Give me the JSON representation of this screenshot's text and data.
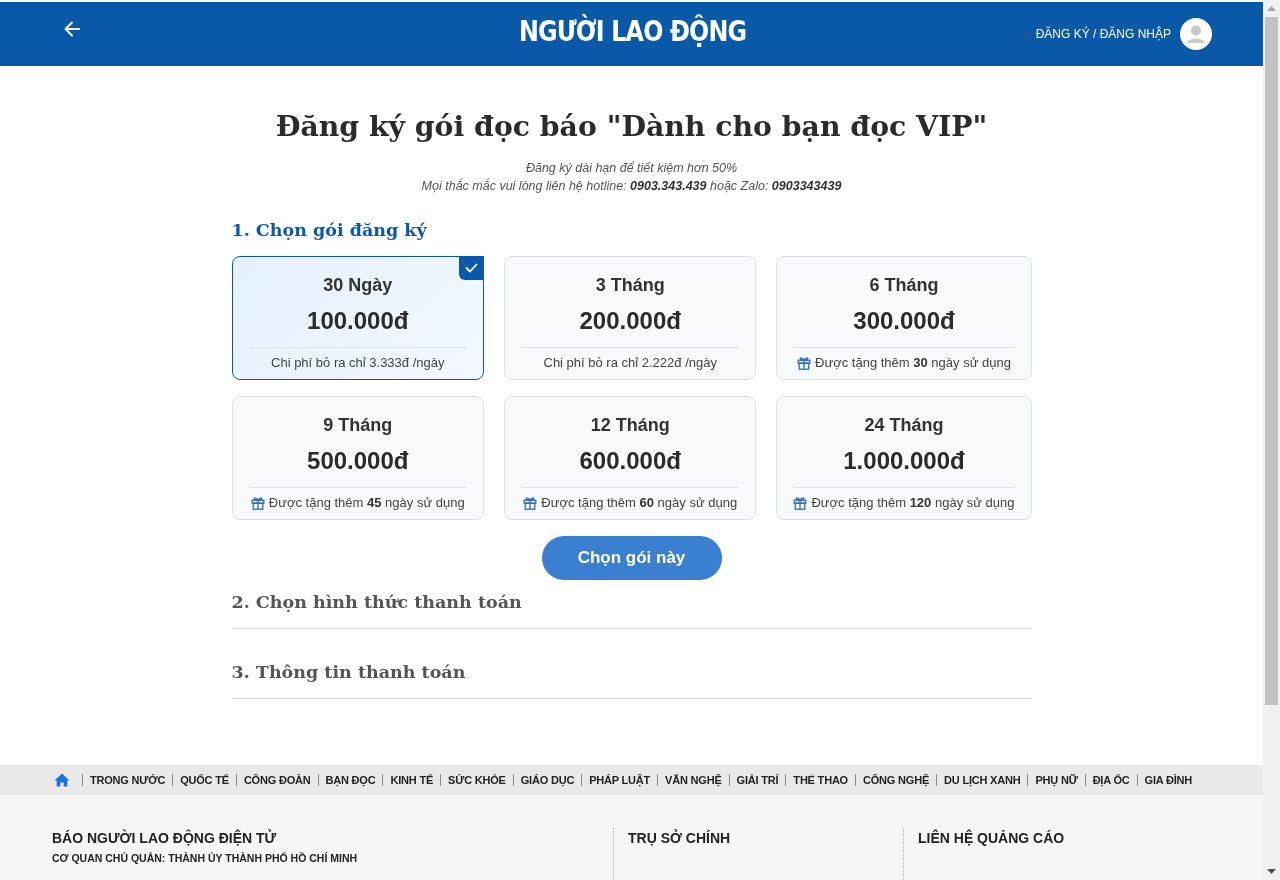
{
  "header": {
    "logo": "NGƯỜI LAO ĐỘNG",
    "auth_link": "ĐĂNG KÝ / ĐĂNG NHẬP"
  },
  "page": {
    "title": "Đăng ký gói đọc báo \"Dành cho bạn đọc VIP\"",
    "subtitle_lines": [
      "Đăng ký dài hạn để tiết kiệm hơn 50%",
      "Mọi thắc mắc vui lòng liên hệ hotline: **0903.343.439** hoặc Zalo: **0903343439**"
    ]
  },
  "steps": [
    {
      "title": "1. Chọn gói đăng ký",
      "active": true,
      "plans": [
        {
          "duration": "30 Ngày",
          "price": "100.000đ",
          "kind": "cost",
          "note": "Chi phí bỏ ra chỉ 3.333đ /ngày",
          "selected": true
        },
        {
          "duration": "3 Tháng",
          "price": "200.000đ",
          "kind": "cost",
          "note": "Chi phí bỏ ra chỉ 2.222đ /ngày",
          "selected": false
        },
        {
          "duration": "6 Tháng",
          "price": "300.000đ",
          "kind": "gift",
          "note": "Được tặng thêm **30** ngày sử dụng",
          "selected": false
        },
        {
          "duration": "9 Tháng",
          "price": "500.000đ",
          "kind": "gift",
          "note": "Được tặng thêm **45** ngày sử dụng",
          "selected": false
        },
        {
          "duration": "12 Tháng",
          "price": "600.000đ",
          "kind": "gift",
          "note": "Được tặng thêm **60** ngày sử dụng",
          "selected": false
        },
        {
          "duration": "24 Tháng",
          "price": "1.000.000đ",
          "kind": "gift",
          "note": "Được tặng thêm **120** ngày sử dụng",
          "selected": false
        }
      ],
      "button": "Chọn gói này"
    },
    {
      "title": "2. Chọn hình thức thanh toán",
      "active": false
    },
    {
      "title": "3. Thông tin thanh toán",
      "active": false
    }
  ],
  "category_nav": {
    "items": [
      "TRONG NƯỚC",
      "QUỐC TẾ",
      "CÔNG ĐOÀN",
      "BẠN ĐỌC",
      "KINH TẾ",
      "SỨC KHỎE",
      "GIÁO DỤC",
      "PHÁP LUẬT",
      "VĂN NGHỆ",
      "GIẢI TRÍ",
      "THỂ THAO",
      "CÔNG NGHỆ",
      "DU LỊCH XANH",
      "PHỤ NỮ",
      "ĐỊA ỐC",
      "GIA ĐÌNH"
    ]
  },
  "footer": {
    "columns": [
      {
        "heading": "BÁO NGƯỜI LAO ĐỘNG ĐIỆN TỬ",
        "lines": [
          "CƠ QUAN CHỦ QUẢN: THÀNH ỦY THÀNH PHỐ HỒ CHÍ MINH"
        ]
      },
      {
        "heading": "TRỤ SỞ CHÍNH"
      },
      {
        "heading": "LIÊN HỆ QUẢNG CÁO"
      }
    ]
  }
}
